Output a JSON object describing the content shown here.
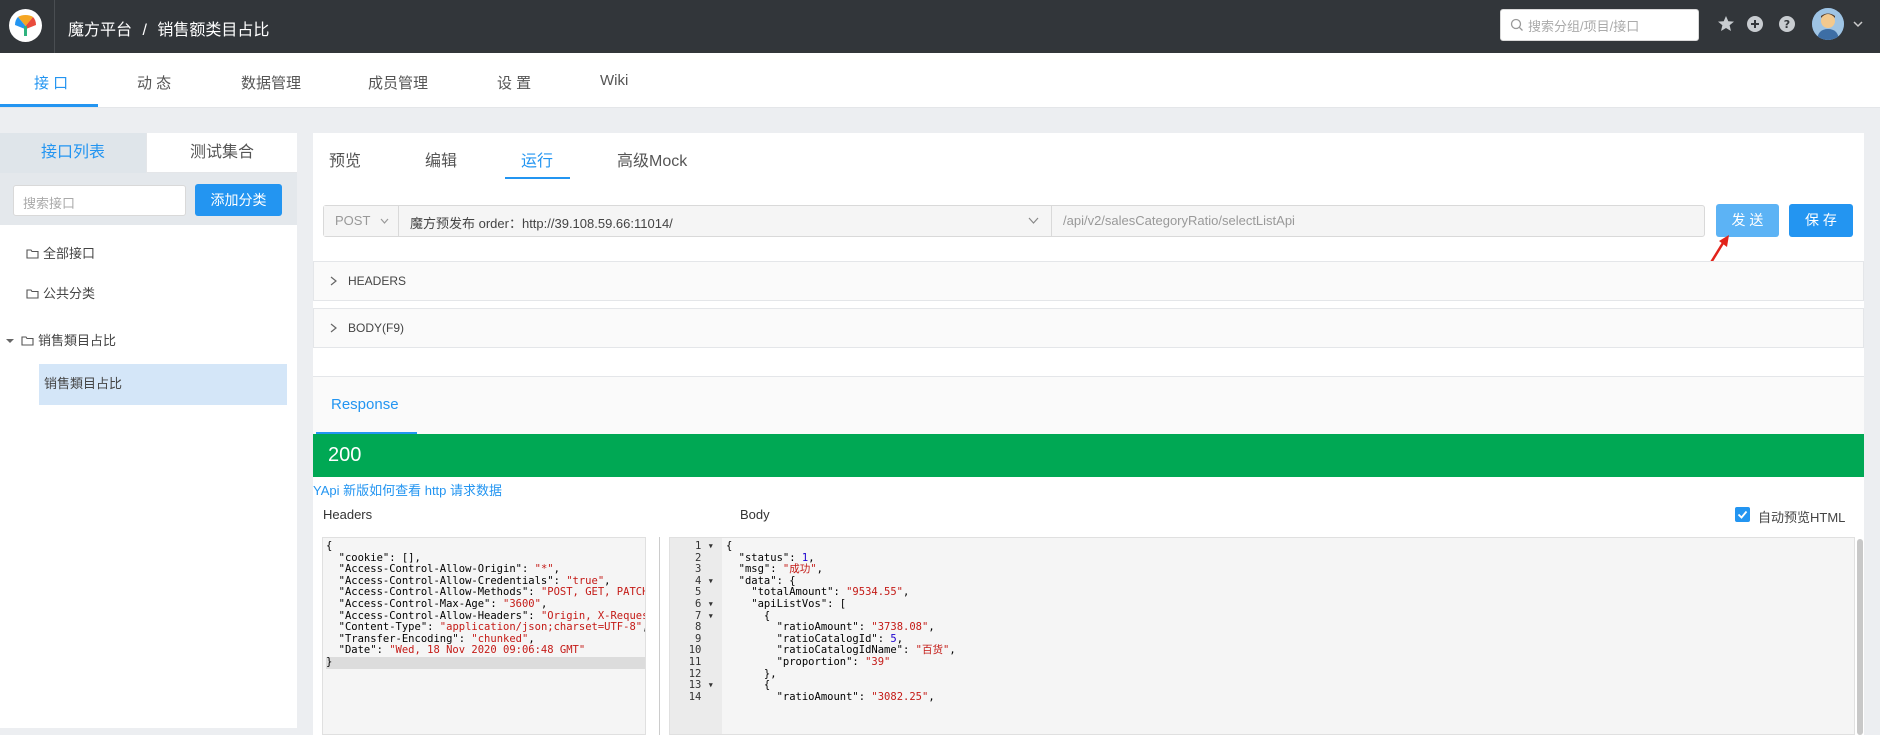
{
  "topbar": {
    "breadcrumb_group": "魔方平台",
    "breadcrumb_sep": "/",
    "breadcrumb_project": "销售额类目占比",
    "search_placeholder": "搜索分组/项目/接口",
    "icons": [
      "star-icon",
      "plus-circle-icon",
      "help-icon",
      "avatar",
      "caret-down-icon"
    ]
  },
  "subnav": {
    "tabs": [
      "接 口",
      "动 态",
      "数据管理",
      "成员管理",
      "设 置",
      "Wiki"
    ],
    "active": 0
  },
  "sidebar": {
    "tabs": [
      "接口列表",
      "测试集合"
    ],
    "search_placeholder": "搜索接口",
    "add_button": "添加分类",
    "items": [
      "全部接口",
      "公共分类",
      "销售類目占比"
    ],
    "sub_items": [
      "销售類目占比"
    ]
  },
  "main": {
    "tabs": [
      "预览",
      "编辑",
      "运行",
      "高级Mock"
    ],
    "active_tab": 2,
    "method": "POST",
    "env": "魔方预发布 order：http://39.108.59.66:11014/",
    "path": "/api/v2/salesCategoryRatio/selectListApi",
    "send_button": "发 送",
    "save_button": "保 存",
    "sections": [
      "HEADERS",
      "BODY(F9)"
    ],
    "response_tab": "Response",
    "status_code": "200",
    "help_link": "YApi 新版如何查看 http 请求数据",
    "headers_label": "Headers",
    "body_label": "Body",
    "auto_preview_label": "自动预览HTML",
    "auto_preview_checked": true,
    "accent_color": "#2395f1",
    "status_color": "#00a854"
  },
  "response_headers": [
    "{",
    "  \"cookie\": [],",
    "  \"Access-Control-Allow-Origin\": \"*\",",
    "  \"Access-Control-Allow-Credentials\": \"true\",",
    "  \"Access-Control-Allow-Methods\": \"POST, GET, PATCH, DELET",
    "  \"Access-Control-Max-Age\": \"3600\",",
    "  \"Access-Control-Allow-Headers\": \"Origin, X-Requested-Wit",
    "  \"Content-Type\": \"application/json;charset=UTF-8\",",
    "  \"Transfer-Encoding\": \"chunked\",",
    "  \"Date\": \"Wed, 18 Nov 2020 09:06:48 GMT\"",
    "}"
  ],
  "response_body": [
    "{",
    "  \"status\": 1,",
    "  \"msg\": \"成功\",",
    "  \"data\": {",
    "    \"totalAmount\": \"9534.55\",",
    "    \"apiListVos\": [",
    "      {",
    "        \"ratioAmount\": \"3738.08\",",
    "        \"ratioCatalogId\": 5,",
    "        \"ratioCatalogIdName\": \"百货\",",
    "        \"proportion\": \"39\"",
    "      },",
    "      {",
    "        \"ratioAmount\": \"3082.25\","
  ],
  "body_line_numbers": [
    "1",
    "2",
    "3",
    "4",
    "5",
    "6",
    "7",
    "8",
    "9",
    "10",
    "11",
    "12",
    "13",
    "14"
  ],
  "body_fold_lines": [
    1,
    4,
    6,
    7,
    13
  ]
}
